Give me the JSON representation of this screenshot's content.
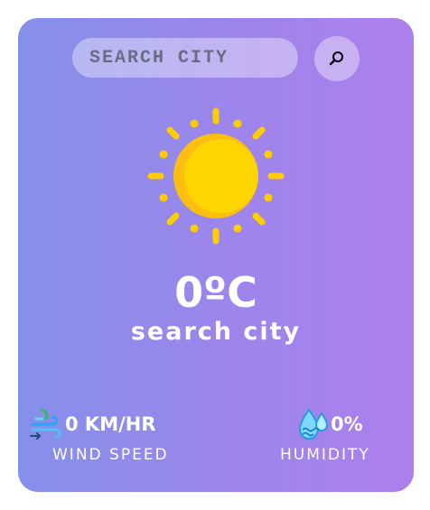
{
  "search": {
    "placeholder": "SEARCH CITY"
  },
  "weather": {
    "temperature": "0ºC",
    "city": "search city",
    "condition_icon": "sun-icon"
  },
  "wind": {
    "value": "0 KM/HR",
    "label": "WIND SPEED",
    "icon": "wind-icon"
  },
  "humidity": {
    "value": "0%",
    "label": "HUMIDITY",
    "icon": "humidity-icon"
  },
  "colors": {
    "gradient_start": "#8590ea",
    "gradient_end": "#ad7fec",
    "sun_yellow": "#ffd400",
    "text": "#ffffff"
  }
}
